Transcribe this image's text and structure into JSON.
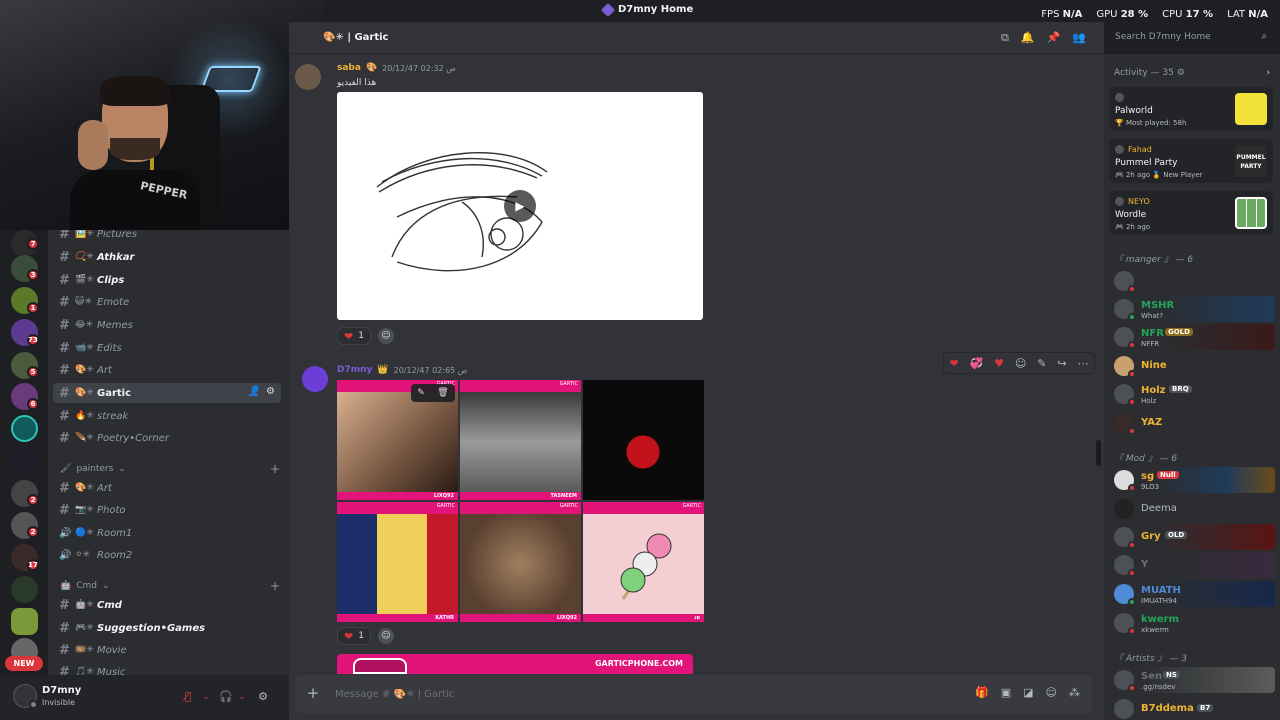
{
  "window": {
    "title": "D7mny Home"
  },
  "perf": {
    "fps_label": "FPS",
    "fps": "N/A",
    "gpu_label": "GPU",
    "gpu": "28 %",
    "cpu_label": "CPU",
    "cpu": "17 %",
    "lat_label": "LAT",
    "lat": "N/A"
  },
  "servers": {
    "badges": [
      "7",
      "3",
      "1",
      "73",
      "5",
      "6",
      "2",
      "2",
      "17"
    ],
    "new_label": "NEW"
  },
  "channels": [
    {
      "label": "Pictures",
      "emoji": "🖼️✳",
      "bold": false
    },
    {
      "label": "Athkar",
      "emoji": "📿✳",
      "bold": true
    },
    {
      "label": "Clips",
      "emoji": "🎬✳",
      "bold": true
    },
    {
      "label": "Emote",
      "emoji": "😺✳",
      "bold": false
    },
    {
      "label": "Memes",
      "emoji": "😂✳",
      "bold": false
    },
    {
      "label": "Edits",
      "emoji": "📹✳",
      "bold": false
    },
    {
      "label": "Art",
      "emoji": "🎨✳",
      "bold": false
    },
    {
      "label": "Gartic",
      "emoji": "🎨✳",
      "bold": false,
      "selected": true
    },
    {
      "label": "streak",
      "emoji": "🔥✳",
      "bold": false
    },
    {
      "label": "Poetry•Corner",
      "emoji": "🪶✳",
      "bold": false
    }
  ],
  "category_painters": "painters",
  "painter_channels": [
    {
      "label": "Art",
      "emoji": "🎨✳"
    },
    {
      "label": "Photo",
      "emoji": "📷✳"
    },
    {
      "label": "Room1",
      "emoji": "🔵✳"
    },
    {
      "label": "Room2",
      "emoji": "⚪✳"
    }
  ],
  "category_cmd": "Cmd",
  "cmd_channels": [
    {
      "label": "Cmd",
      "emoji": "🤖✳",
      "bold": true
    },
    {
      "label": "Suggestion•Games",
      "emoji": "🎮✳",
      "bold": true
    },
    {
      "label": "Movie",
      "emoji": "🎞️✳",
      "bold": false
    },
    {
      "label": "Music",
      "emoji": "🎵✳",
      "bold": false
    }
  ],
  "user": {
    "name": "D7mny",
    "status": "Invisible"
  },
  "header": {
    "channel": "| Gartic",
    "emoji": "🎨✳"
  },
  "search": {
    "placeholder": "Search D7mny Home"
  },
  "messages": {
    "first": {
      "author": "saba",
      "emoji": "🎨",
      "time": "20/12/47 02:32 ص",
      "text": "هذا الفيديو",
      "reaction_count": "1"
    },
    "second": {
      "author": "D7mny",
      "emoji": "👑",
      "time": "20/12/47 02:65 ص",
      "reaction_count": "1"
    }
  },
  "tiles": [
    {
      "credit": "LIXQ92",
      "tag": "GARTIC",
      "color": "#c0a080"
    },
    {
      "credit": "TASNEEM",
      "tag": "GARTIC",
      "color": "#7a7a7a"
    },
    {
      "credit": "",
      "tag": "",
      "color": "#0a0a0a"
    },
    {
      "credit": "KATHR",
      "tag": "GARTIC",
      "color": "#2a3f7a"
    },
    {
      "credit": "LIXQ92",
      "tag": "GARTIC",
      "color": "#7a5a46"
    },
    {
      "credit": "ᴊᴅ",
      "tag": "GARTIC",
      "color": "#f3cfd2"
    }
  ],
  "banner": {
    "url": "GARTICPHONE.COM"
  },
  "composer": {
    "placeholder": "Message # 🎨✳ | Gartic"
  },
  "members": {
    "activity_header": "Activity — 35 ⚙",
    "activities": [
      {
        "who": "",
        "game": "Palworld",
        "meta": "🏆 Most played: 58h",
        "thumb_color": "#f2e23a"
      },
      {
        "who": "Fahad",
        "game": "Pummel Party",
        "meta": "🎮 2h ago  🏅 New Player",
        "thumb_color": "#2b2b2b"
      },
      {
        "who": "NEYO",
        "game": "Wordle",
        "meta": "🎮 2h ago",
        "thumb_color": "#ffffff"
      }
    ],
    "role_manger": "『 manger 』 — 6",
    "managers": [
      {
        "name": "",
        "sub": "",
        "color": "#dbdee1",
        "bg": "#2b2d31",
        "tag": ""
      },
      {
        "name": "MSHR",
        "sub": "What?",
        "color": "#23a55a",
        "bg": "#1f3b5a",
        "tag": ""
      },
      {
        "name": "NFR",
        "sub": "NFFR",
        "color": "#23a55a",
        "bg": "#3a1a1a",
        "tag": "GOLD"
      },
      {
        "name": "Nine",
        "sub": "",
        "color": "#f0b232",
        "bg": "#2b2d31",
        "tag": ""
      },
      {
        "name": "Holz",
        "sub": "Holz",
        "color": "#f0b232",
        "bg": "#2b2d31",
        "tag": "BRQ"
      },
      {
        "name": "YAZ",
        "sub": "",
        "color": "#f0b232",
        "bg": "#2b2d31",
        "tag": ""
      }
    ],
    "role_mod": "『 Mod 』 — 6",
    "mods": [
      {
        "name": "sg",
        "sub": "9LO3",
        "color": "#f0b232",
        "bg": "#1f3b5a",
        "tag": "Null"
      },
      {
        "name": "Deema",
        "sub": "",
        "color": "#dbdee1",
        "bg": "#2b2d31",
        "tag": ""
      },
      {
        "name": "Gry",
        "sub": "",
        "color": "#f0b232",
        "bg": "#3a1a1a",
        "tag": "OLD"
      },
      {
        "name": "Y",
        "sub": "",
        "color": "#dbdee1",
        "bg": "#3a2a3f",
        "tag": ""
      },
      {
        "name": "MUATH",
        "sub": "IMUATH94",
        "color": "#4f8bd6",
        "bg": "#16284a",
        "tag": ""
      },
      {
        "name": "kwerm",
        "sub": "xkwerm",
        "color": "#23a55a",
        "bg": "#2b2d31",
        "tag": ""
      }
    ],
    "role_artists": "『 Artists 』 — 3",
    "artists": [
      {
        "name": "Sen",
        "sub": ".gg/nsdev",
        "color": "#dbdee1",
        "bg": "#3a3d3a",
        "tag": "NS"
      },
      {
        "name": "B7ddema",
        "sub": "",
        "color": "#f0b232",
        "bg": "#2b2d31",
        "tag": "B7"
      }
    ]
  }
}
